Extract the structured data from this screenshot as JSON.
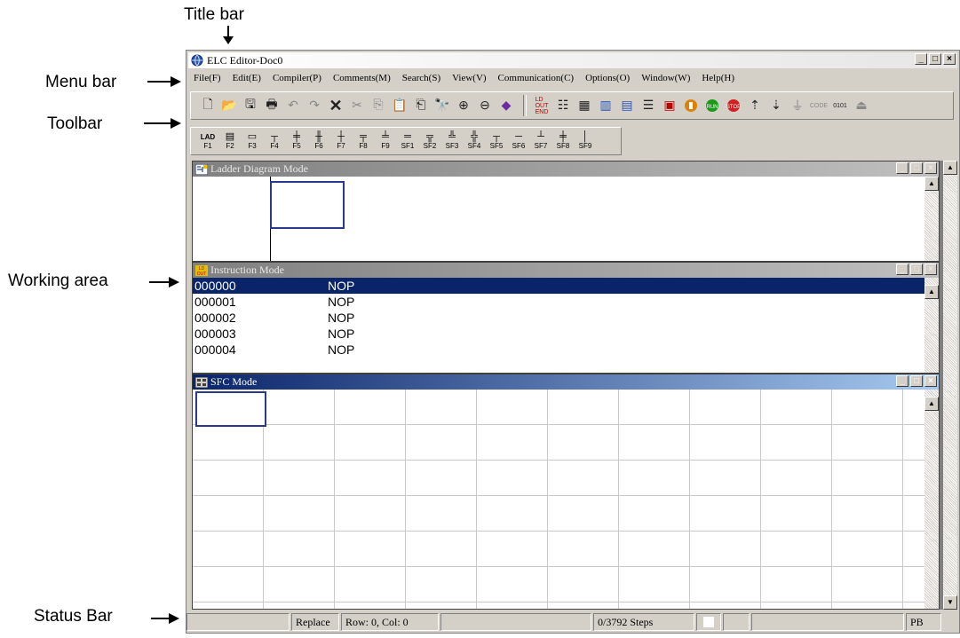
{
  "annotations": {
    "title_bar": "Title bar",
    "menu_bar": "Menu bar",
    "toolbar": "Toolbar",
    "working_area": "Working area",
    "status_bar": "Status Bar"
  },
  "window": {
    "title": "ELC Editor-Doc0",
    "buttons": {
      "minimize": "_",
      "maximize": "□",
      "close": "×"
    }
  },
  "menu": [
    "File(F)",
    "Edit(E)",
    "Compiler(P)",
    "Comments(M)",
    "Search(S)",
    "View(V)",
    "Communication(C)",
    "Options(O)",
    "Window(W)",
    "Help(H)"
  ],
  "toolbar1": {
    "file_buttons": [
      "new-icon",
      "open-icon",
      "save-icon",
      "print-icon",
      "undo-icon",
      "redo-icon",
      "delete-icon",
      "cut-icon",
      "copy-icon",
      "paste-icon",
      "paste-special-icon",
      "find-icon",
      "zoom-in-icon",
      "zoom-out-icon",
      "book-icon"
    ],
    "plc_buttons": [
      "ld-out-end-icon",
      "ladder-list-icon",
      "monitor-icon",
      "device-table-icon",
      "sfc-table-icon",
      "compile-icon",
      "ladder-run-icon",
      "stop-circle-icon",
      "run-button-icon",
      "stop-button-icon",
      "upload-icon",
      "download-icon",
      "contact-icon",
      "code-icon",
      "binary-icon",
      "transfer-icon"
    ]
  },
  "toolbar2": {
    "keys": [
      {
        "glyph": "LAD",
        "label": "F1"
      },
      {
        "glyph": "▤",
        "label": "F2"
      },
      {
        "glyph": "▭",
        "label": "F3"
      },
      {
        "glyph": "┬",
        "label": "F4"
      },
      {
        "glyph": "╪",
        "label": "F5"
      },
      {
        "glyph": "╫",
        "label": "F6"
      },
      {
        "glyph": "┼",
        "label": "F7"
      },
      {
        "glyph": "╤",
        "label": "F8"
      },
      {
        "glyph": "╧",
        "label": "F9"
      },
      {
        "glyph": "═",
        "label": "SF1"
      },
      {
        "glyph": "╦",
        "label": "SF2"
      },
      {
        "glyph": "╩",
        "label": "SF3"
      },
      {
        "glyph": "╬",
        "label": "SF4"
      },
      {
        "glyph": "┬",
        "label": "SF5"
      },
      {
        "glyph": "─",
        "label": "SF6"
      },
      {
        "glyph": "┴",
        "label": "SF7"
      },
      {
        "glyph": "╪",
        "label": "SF8"
      },
      {
        "glyph": "│",
        "label": "SF9"
      }
    ]
  },
  "ladder_window": {
    "title": "Ladder Diagram Mode"
  },
  "instruction_window": {
    "title": "Instruction Mode",
    "rows": [
      {
        "addr": "000000",
        "op": "NOP"
      },
      {
        "addr": "000001",
        "op": "NOP"
      },
      {
        "addr": "000002",
        "op": "NOP"
      },
      {
        "addr": "000003",
        "op": "NOP"
      },
      {
        "addr": "000004",
        "op": "NOP"
      }
    ]
  },
  "sfc_window": {
    "title": "SFC Mode"
  },
  "status": {
    "mode": "Replace",
    "position": "Row: 0, Col: 0",
    "steps": "0/3792 Steps",
    "tag": "PB"
  },
  "colors": {
    "active_title": "#0a246a",
    "selection": "#0a246a",
    "chrome": "#d4d0c8"
  }
}
